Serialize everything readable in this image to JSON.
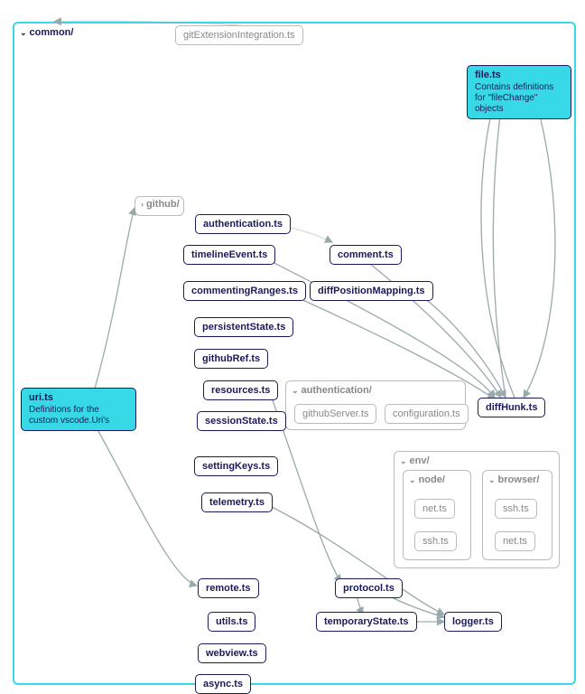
{
  "groups": {
    "common": {
      "label": "common/",
      "chev": "⌄"
    },
    "github": {
      "label": "github/",
      "chev": "›"
    },
    "authentication": {
      "label": "authentication/",
      "chev": "⌄"
    },
    "env": {
      "label": "env/",
      "chev": "⌄"
    },
    "node": {
      "label": "node/",
      "chev": "⌄"
    },
    "browser": {
      "label": "browser/",
      "chev": "⌄"
    }
  },
  "nodes": {
    "gitExtensionIntegration": "gitExtensionIntegration.ts",
    "file": {
      "label": "file.ts",
      "desc": "Contains definitions for\n\"fileChange\" objects"
    },
    "uri": {
      "label": "uri.ts",
      "desc": "Definitions for the custom vscode.Uri's"
    },
    "authenticationTs": "authentication.ts",
    "timelineEvent": "timelineEvent.ts",
    "comment": "comment.ts",
    "commentingRanges": "commentingRanges.ts",
    "diffPositionMapping": "diffPositionMapping.ts",
    "persistentState": "persistentState.ts",
    "githubRef": "githubRef.ts",
    "resources": "resources.ts",
    "sessionState": "sessionState.ts",
    "settingKeys": "settingKeys.ts",
    "telemetry": "telemetry.ts",
    "diffHunk": "diffHunk.ts",
    "githubServer": "githubServer.ts",
    "configuration": "configuration.ts",
    "remote": "remote.ts",
    "protocol": "protocol.ts",
    "utils": "utils.ts",
    "temporaryState": "temporaryState.ts",
    "logger": "logger.ts",
    "webview": "webview.ts",
    "async": "async.ts",
    "node_net": "net.ts",
    "node_ssh": "ssh.ts",
    "browser_ssh": "ssh.ts",
    "browser_net": "net.ts"
  }
}
